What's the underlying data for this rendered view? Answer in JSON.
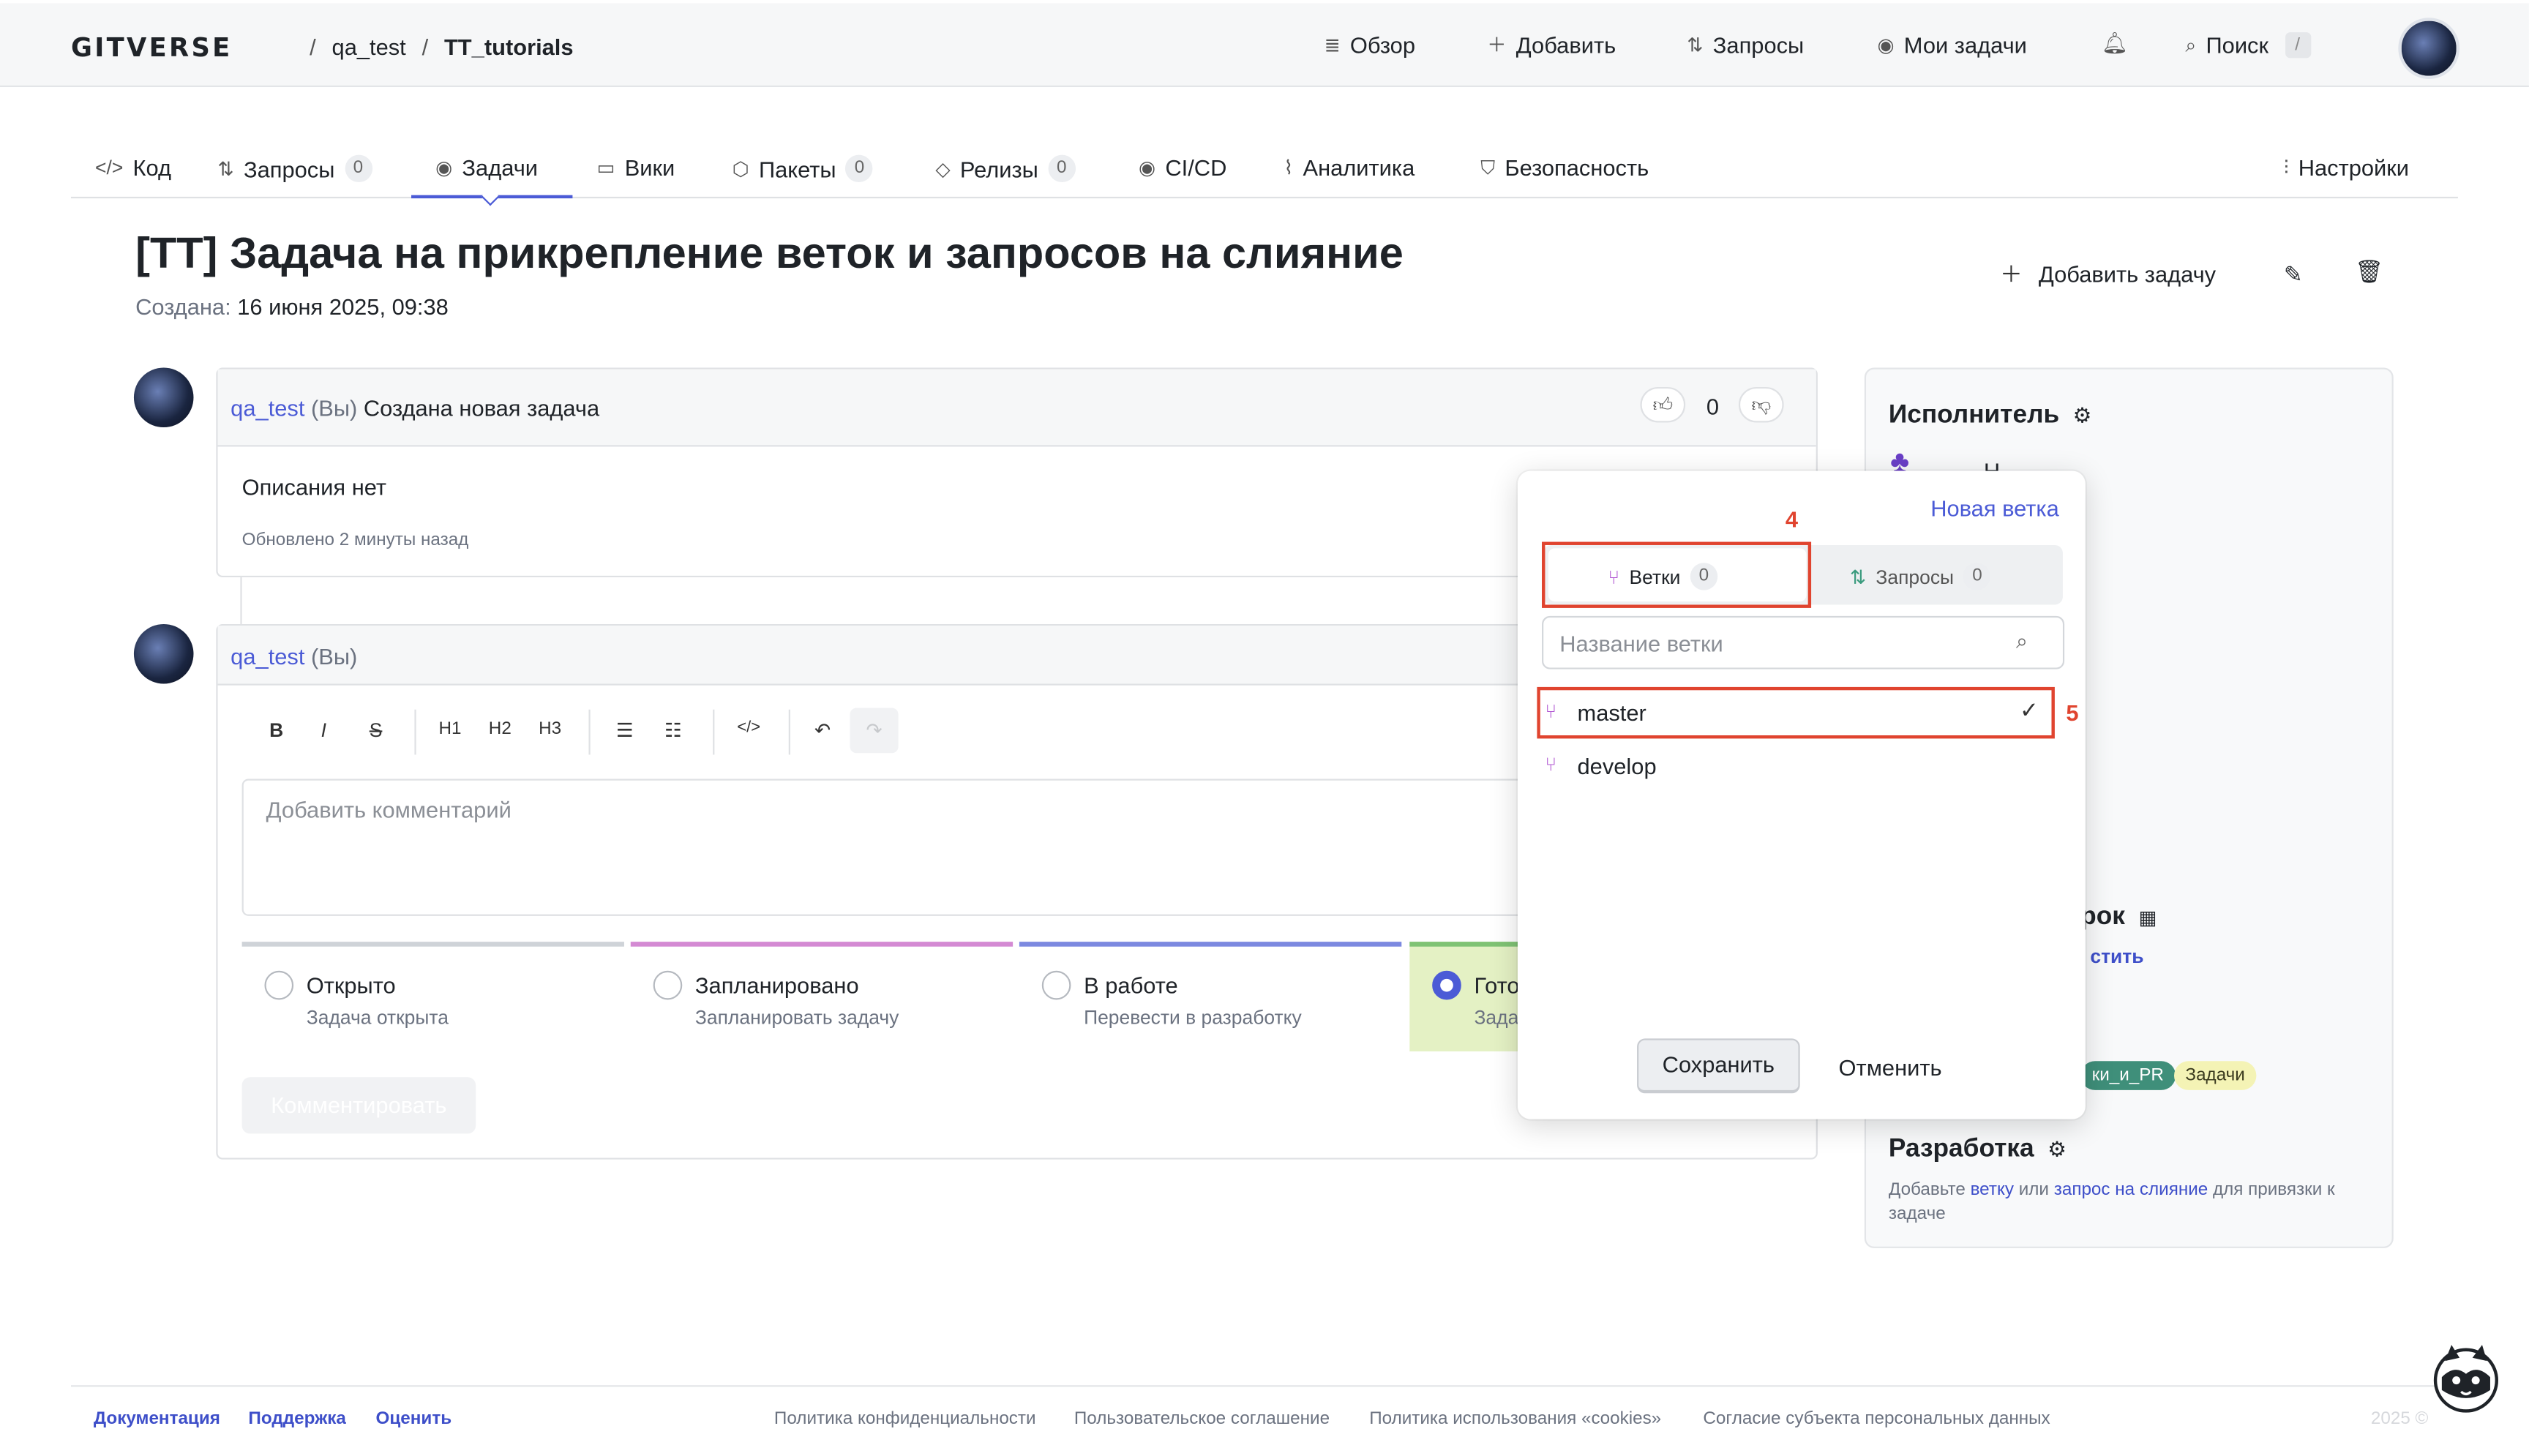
{
  "header": {
    "logo": "GITVERSE",
    "breadcrumb": {
      "owner": "qa_test",
      "separator": "/",
      "repo": "TT_tutorials"
    },
    "nav": [
      {
        "icon": "overview-icon",
        "label": "Обзор"
      },
      {
        "icon": "plus-icon",
        "label": "Добавить"
      },
      {
        "icon": "pull-request-icon",
        "label": "Запросы"
      },
      {
        "icon": "issue-icon",
        "label": "Мои задачи"
      }
    ],
    "search_label": "Поиск",
    "search_shortcut": "/"
  },
  "tabs": {
    "items": [
      {
        "icon": "code-icon",
        "label": "Код",
        "count": null
      },
      {
        "icon": "pull-request-icon",
        "label": "Запросы",
        "count": "0"
      },
      {
        "icon": "issue-icon",
        "label": "Задачи",
        "count": null,
        "active": true
      },
      {
        "icon": "book-icon",
        "label": "Вики",
        "count": null
      },
      {
        "icon": "package-icon",
        "label": "Пакеты",
        "count": "0"
      },
      {
        "icon": "tag-icon",
        "label": "Релизы",
        "count": "0"
      },
      {
        "icon": "cicd-icon",
        "label": "CI/CD",
        "count": null
      },
      {
        "icon": "analytics-icon",
        "label": "Аналитика",
        "count": null
      },
      {
        "icon": "shield-icon",
        "label": "Безопасность",
        "count": null
      }
    ],
    "settings_label": "Настройки"
  },
  "issue": {
    "title": "[TT] Задача на прикрепление веток и запросов на слияние",
    "created_label": "Создана:",
    "created_value": "16 июня 2025, 09:38",
    "add_task_label": "Добавить задачу"
  },
  "first_comment": {
    "user": "qa_test",
    "you": "(Вы)",
    "action": "Создана новая задача",
    "reaction_count": "0",
    "body": "Описания нет",
    "updated": "Обновлено 2 минуты назад"
  },
  "new_comment": {
    "user": "qa_test",
    "you": "(Вы)",
    "toolbar": [
      "B",
      "I",
      "S",
      "H1",
      "H2",
      "H3",
      "• list",
      "1. list",
      "</>",
      "undo",
      "redo"
    ],
    "placeholder": "Добавить комментарий",
    "submit_label": "Комментировать",
    "statuses": [
      {
        "label": "Открыто",
        "desc": "Задача открыта",
        "color": "#cfd3d8",
        "selected": false
      },
      {
        "label": "Запланировано",
        "desc": "Запланировать задачу",
        "color": "#d48ad3",
        "selected": false
      },
      {
        "label": "В работе",
        "desc": "Перевести в разработку",
        "color": "#7c89e0",
        "selected": false
      },
      {
        "label": "Гото",
        "desc": "Зада",
        "color": "#7fc374",
        "selected": true
      }
    ]
  },
  "sidebar": {
    "assignee_label": "Исполнитель",
    "assignee_partial": "Н",
    "deadline_partial": "рок",
    "deadline_link_partial": "стить",
    "tags": [
      {
        "label": "ки_и_PR",
        "bg": "#3f8f7a",
        "fg": "#ffffff"
      },
      {
        "label": "Задачи",
        "bg": "#f4f3b5",
        "fg": "#3b3b1f"
      }
    ],
    "development_label": "Разработка",
    "development_text_1": "Добавьте",
    "development_link_1": "ветку",
    "development_text_2": "или",
    "development_link_2": "запрос на слияние",
    "development_text_3": "для привязки к задаче"
  },
  "popup": {
    "new_branch_label": "Новая ветка",
    "tab_branches": "Ветки",
    "tab_branches_count": "0",
    "tab_requests": "Запросы",
    "tab_requests_count": "0",
    "search_placeholder": "Название ветки",
    "branches": [
      {
        "name": "master",
        "selected": true
      },
      {
        "name": "develop",
        "selected": false
      }
    ],
    "save_label": "Сохранить",
    "cancel_label": "Отменить"
  },
  "annotations": {
    "step4": "4",
    "step5": "5",
    "color": "#e0442f"
  },
  "footer": {
    "links_left": [
      "Документация",
      "Поддержка",
      "Оценить"
    ],
    "links_center": [
      "Политика конфиденциальности",
      "Пользовательское соглашение",
      "Политика использования «cookies»",
      "Согласие субъекта персональных данных"
    ],
    "year": "2025 ©"
  }
}
